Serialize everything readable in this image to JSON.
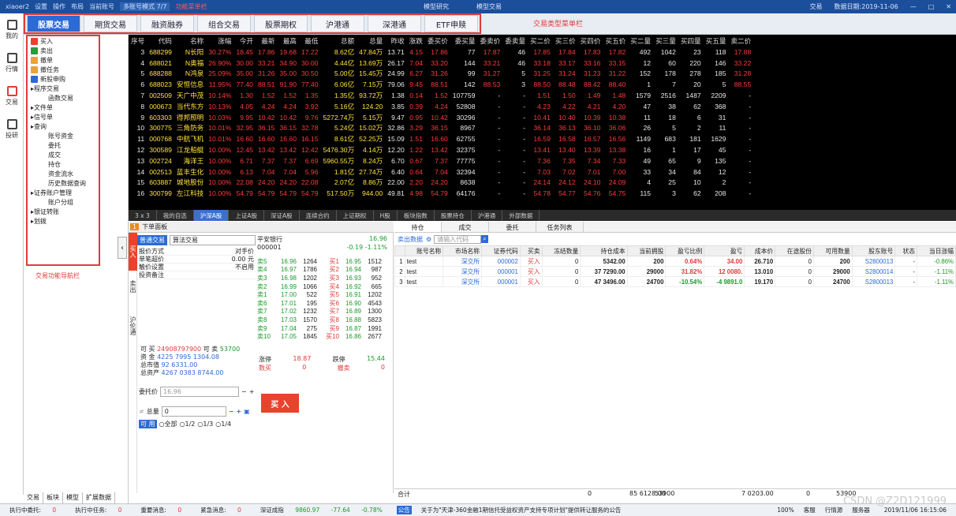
{
  "titlebar": {
    "user": "xiaoer2",
    "settings": "设置",
    "operate": "操作",
    "layout": "布局",
    "account_label": "当前账号",
    "account_mode": "多账号模式 7/7",
    "top_note": "功能菜单栏",
    "research": "模型研究",
    "model_trade": "模型交易",
    "trade": "交易",
    "date": "数据日期:2019-11-06"
  },
  "iconbar": [
    {
      "label": "我的",
      "icon": "home-icon"
    },
    {
      "label": "行情",
      "icon": "chart-icon"
    },
    {
      "label": "交易",
      "icon": "trade-icon"
    },
    {
      "label": "投研",
      "icon": "research-icon"
    }
  ],
  "tabs": [
    "股票交易",
    "期货交易",
    "融资融券",
    "组合交易",
    "股票期权",
    "沪港通",
    "深港通",
    "ETF申赎"
  ],
  "tabs_note": "交易类型菜单栏",
  "nav": [
    {
      "label": "买入",
      "kind": "item",
      "color": "#e8432c"
    },
    {
      "label": "卖出",
      "kind": "item",
      "color": "#2a9a3a"
    },
    {
      "label": "撤单",
      "kind": "item",
      "color": "#e9a23b"
    },
    {
      "label": "撤任务",
      "kind": "item",
      "color": "#e9a23b"
    },
    {
      "label": "新股申购",
      "kind": "item",
      "color": "#2c6ad6"
    },
    {
      "label": "程序交易",
      "kind": "grp"
    },
    {
      "label": "函数交易",
      "kind": "sub"
    },
    {
      "label": "文件单",
      "kind": "grp"
    },
    {
      "label": "信号单",
      "kind": "grp"
    },
    {
      "label": "查询",
      "kind": "grp"
    },
    {
      "label": "账号资金",
      "kind": "sub"
    },
    {
      "label": "委托",
      "kind": "sub"
    },
    {
      "label": "成交",
      "kind": "sub"
    },
    {
      "label": "持仓",
      "kind": "sub"
    },
    {
      "label": "资金流水",
      "kind": "sub"
    },
    {
      "label": "历史数据查询",
      "kind": "sub"
    },
    {
      "label": "证券账户管理",
      "kind": "grp"
    },
    {
      "label": "账户分组",
      "kind": "sub"
    },
    {
      "label": "银证转账",
      "kind": "grp"
    },
    {
      "label": "划拨",
      "kind": "grp"
    }
  ],
  "nav_note": "交易功能导航栏",
  "left_bottom_tabs": [
    "交易",
    "板块",
    "模型",
    "扩展数据"
  ],
  "quote": {
    "headers": [
      "序号",
      "代码",
      "名称",
      "涨幅",
      "今开",
      "最新",
      "最高",
      "最低",
      "总额",
      "总量",
      "昨收",
      "涨跌",
      "委买价",
      "委买量",
      "委卖价",
      "委卖量",
      "买二价",
      "买三价",
      "买四价",
      "买五价",
      "买二量",
      "买三量",
      "买四量",
      "买五量",
      "卖二价"
    ],
    "rows": [
      [
        "3",
        "688299",
        "N长阳",
        "30.27%",
        "18.45",
        "17.86",
        "19.68",
        "17.22",
        "8.62亿",
        "47.84万",
        "13.71",
        "4.15",
        "17.86",
        "77",
        "17.87",
        "46",
        "17.85",
        "17.84",
        "17.83",
        "17.82",
        "492",
        "1042",
        "23",
        "118",
        "17.88"
      ],
      [
        "4",
        "688021",
        "N奥福",
        "26.90%",
        "30.00",
        "33.21",
        "34.90",
        "30.00",
        "4.44亿",
        "13.69万",
        "26.17",
        "7.04",
        "33.20",
        "144",
        "33.21",
        "46",
        "33.18",
        "33.17",
        "33.16",
        "33.15",
        "12",
        "60",
        "220",
        "146",
        "33.22"
      ],
      [
        "5",
        "688288",
        "N鸿泉",
        "25.09%",
        "35.00",
        "31.26",
        "35.00",
        "30.50",
        "5.00亿",
        "15.45万",
        "24.99",
        "6.27",
        "31.26",
        "99",
        "31.27",
        "5",
        "31.25",
        "31.24",
        "31.23",
        "31.22",
        "152",
        "178",
        "278",
        "185",
        "31.28"
      ],
      [
        "6",
        "688023",
        "安恒信息",
        "11.95%",
        "77.40",
        "88.51",
        "91.90",
        "77.40",
        "6.06亿",
        "7.15万",
        "79.06",
        "9.45",
        "88.51",
        "142",
        "88.53",
        "3",
        "88.50",
        "88.48",
        "88.42",
        "88.40",
        "1",
        "7",
        "20",
        "5",
        "88.55"
      ],
      [
        "7",
        "002509",
        "天广中茂",
        "10.14%",
        "1.30",
        "1.52",
        "1.52",
        "1.35",
        "1.35亿",
        "93.72万",
        "1.38",
        "0.14",
        "1.52",
        "107759",
        "-",
        "-",
        "1.51",
        "1.50",
        "1.49",
        "1.48",
        "1579",
        "2516",
        "1487",
        "2209",
        "-"
      ],
      [
        "8",
        "000673",
        "当代东方",
        "10.13%",
        "4.05",
        "4.24",
        "4.24",
        "3.92",
        "5.16亿",
        "124.20",
        "3.85",
        "0.39",
        "4.24",
        "52808",
        "-",
        "-",
        "4.23",
        "4.22",
        "4.21",
        "4.20",
        "47",
        "38",
        "62",
        "368",
        "-"
      ],
      [
        "9",
        "603303",
        "得邦照明",
        "10.03%",
        "9.95",
        "10.42",
        "10.42",
        "9.76",
        "5272.74万",
        "5.15万",
        "9.47",
        "0.95",
        "10.42",
        "30296",
        "-",
        "-",
        "10.41",
        "10.40",
        "10.39",
        "10.38",
        "11",
        "18",
        "6",
        "31",
        "-"
      ],
      [
        "10",
        "300775",
        "三角防务",
        "10.01%",
        "32.95",
        "36.15",
        "36.15",
        "32.78",
        "5.24亿",
        "15.02万",
        "32.86",
        "3.29",
        "36.15",
        "8967",
        "-",
        "-",
        "36.14",
        "36.13",
        "36.10",
        "36.06",
        "26",
        "5",
        "2",
        "11",
        "-"
      ],
      [
        "11",
        "000768",
        "中航飞机",
        "10.01%",
        "16.60",
        "16.60",
        "16.60",
        "16.15",
        "8.61亿",
        "52.25万",
        "15.09",
        "1.51",
        "16.60",
        "62755",
        "-",
        "-",
        "16.59",
        "16.58",
        "16.57",
        "16.56",
        "1149",
        "683",
        "181",
        "1629",
        "-"
      ],
      [
        "12",
        "300589",
        "江龙船艇",
        "10.00%",
        "12.45",
        "13.42",
        "13.42",
        "12.42",
        "5476.30万",
        "4.14万",
        "12.20",
        "1.22",
        "13.42",
        "32375",
        "-",
        "-",
        "13.41",
        "13.40",
        "13.39",
        "13.38",
        "16",
        "1",
        "17",
        "45",
        "-"
      ],
      [
        "13",
        "002724",
        "海洋王",
        "10.00%",
        "6.71",
        "7.37",
        "7.37",
        "6.69",
        "5960.55万",
        "8.24万",
        "6.70",
        "0.67",
        "7.37",
        "77775",
        "-",
        "-",
        "7.36",
        "7.35",
        "7.34",
        "7.33",
        "49",
        "65",
        "9",
        "135",
        "-"
      ],
      [
        "14",
        "002513",
        "蓝丰生化",
        "10.00%",
        "6.13",
        "7.04",
        "7.04",
        "5.96",
        "1.81亿",
        "27.74万",
        "6.40",
        "0.64",
        "7.04",
        "32394",
        "-",
        "-",
        "7.03",
        "7.02",
        "7.01",
        "7.00",
        "33",
        "34",
        "84",
        "12",
        "-"
      ],
      [
        "15",
        "603887",
        "城地股份",
        "10.00%",
        "22.08",
        "24.20",
        "24.20",
        "22.08",
        "2.07亿",
        "8.86万",
        "22.00",
        "2.20",
        "24.20",
        "8638",
        "-",
        "-",
        "24.14",
        "24.12",
        "24.10",
        "24.09",
        "4",
        "25",
        "10",
        "2",
        "-"
      ],
      [
        "16",
        "300799",
        "左江科技",
        "10.00%",
        "54.79",
        "54.79",
        "54.79",
        "54.79",
        "517.50万",
        "944.00",
        "49.81",
        "4.98",
        "54.79",
        "64176",
        "-",
        "-",
        "54.78",
        "54.77",
        "54.76",
        "54.75",
        "115",
        "3",
        "62",
        "208",
        "-"
      ]
    ]
  },
  "subtabs": [
    "3 x 3",
    "我的自选",
    "沪深A股",
    "上证A股",
    "深证A股",
    "连续合约",
    "上证期权",
    "H股",
    "板块指数",
    "股票持仓",
    "沪港通",
    "外部数据"
  ],
  "order": {
    "panel_title": "下单面板",
    "mode_tab": "普通交易",
    "mode_select": "算法交易",
    "side_tabs": [
      "买入",
      "卖出",
      "沪伦通"
    ],
    "form": [
      {
        "k": "报价方式",
        "v": "对手价"
      },
      {
        "k": "单笔超价",
        "v": "0.00 元"
      },
      {
        "k": "触价设置",
        "v": "不启用"
      },
      {
        "k": "投资备注",
        "v": ""
      }
    ],
    "stock_name": "平安银行",
    "stock_code": "000001",
    "stock_price": "16.96",
    "stock_chg": "-0.19",
    "stock_pct": "-1.11%",
    "depth": [
      {
        "sl": "卖5",
        "sp": "16.96",
        "sv": "1264",
        "bl": "买1",
        "bp": "16.95",
        "bv": "1512"
      },
      {
        "sl": "卖4",
        "sp": "16.97",
        "sv": "1786",
        "bl": "买2",
        "bp": "16.94",
        "bv": "987"
      },
      {
        "sl": "卖3",
        "sp": "16.98",
        "sv": "1202",
        "bl": "买3",
        "bp": "16.93",
        "bv": "952"
      },
      {
        "sl": "卖2",
        "sp": "16.99",
        "sv": "1066",
        "bl": "买4",
        "bp": "16.92",
        "bv": "665"
      },
      {
        "sl": "卖1",
        "sp": "17.00",
        "sv": "522",
        "bl": "买5",
        "bp": "16.91",
        "bv": "1202"
      },
      {
        "sl": "卖6",
        "sp": "17.01",
        "sv": "195",
        "bl": "买6",
        "bp": "16.90",
        "bv": "4543"
      },
      {
        "sl": "卖7",
        "sp": "17.02",
        "sv": "1232",
        "bl": "买7",
        "bp": "16.89",
        "bv": "1300"
      },
      {
        "sl": "卖8",
        "sp": "17.03",
        "sv": "1570",
        "bl": "买8",
        "bp": "16.88",
        "bv": "5823"
      },
      {
        "sl": "卖9",
        "sp": "17.04",
        "sv": "275",
        "bl": "买9",
        "bp": "16.87",
        "bv": "1991"
      },
      {
        "sl": "卖10",
        "sp": "17.05",
        "sv": "1845",
        "bl": "买10",
        "bp": "16.86",
        "bv": "2677"
      }
    ],
    "funds": {
      "buyable_label": "可 买",
      "buyable": "24908797900",
      "sellable_label": "可 卖",
      "sellable": "53700",
      "cash_label": "资 金",
      "cash": "4225 7995 1304.08",
      "mv_label": "总市值",
      "mv": "92 6331.00",
      "assets_label": "总资产",
      "assets": "4267 0383 8744.00"
    },
    "limit_up_label": "涨停",
    "limit_up": "18.87",
    "limit_down_label": "跌停",
    "limit_down": "15.44",
    "count_label": "数买",
    "count": "0",
    "cancel_label": "撤卖",
    "cancel": "0",
    "price_label": "委托价",
    "price_placeholder": "16.96",
    "qty_label": "总量",
    "qty_value": "0",
    "ratio_label": "可 用",
    "ratio_opts": [
      "全部",
      "1/2",
      "1/3",
      "1/4"
    ],
    "buy_btn": "买 入"
  },
  "positions": {
    "tabs": [
      "持仓",
      "成交",
      "委托",
      "任务列表"
    ],
    "export": "卖出数据",
    "search_placeholder": "请输入代码",
    "headers": [
      "",
      "账号名称",
      "市场名称",
      "证券代码",
      "买卖",
      "冻结数量",
      "持仓成本",
      "当前拥股",
      "盈亏比例",
      "盈亏",
      "成本价",
      "在途股份",
      "可用数量",
      "股东账号",
      "状态",
      "当日涨幅"
    ],
    "rows": [
      [
        "1",
        "test",
        "深交所",
        "000002",
        "买入",
        "0",
        "5342.00",
        "200",
        "0.64%",
        "34.00",
        "26.710",
        "0",
        "200",
        "S2800013",
        "-",
        "-0.86%"
      ],
      [
        "2",
        "test",
        "深交所",
        "000001",
        "买入",
        "0",
        "37 7290.00",
        "29000",
        "31.82%",
        "12 0080.",
        "13.010",
        "0",
        "29000",
        "S2800014",
        "-",
        "-1.11%"
      ],
      [
        "3",
        "test",
        "深交所",
        "000001",
        "买入",
        "0",
        "47 3496.00",
        "24700",
        "-10.54%",
        "-4 9891.0",
        "19.170",
        "0",
        "24700",
        "S2800013",
        "-",
        "-1.11%"
      ]
    ],
    "total_label": "合计",
    "total": [
      "0",
      "85 6128.00",
      "53900",
      "",
      "7 0203.00",
      "",
      "0",
      "53900"
    ]
  },
  "statusbar": {
    "exec_label": "执行中委托:",
    "exec": "0",
    "task_label": "执行中任务:",
    "task": "0",
    "msg_label": "重要消息:",
    "msg": "0",
    "urgent_label": "紧急消息:",
    "urgent": "0",
    "index_name": "深证成指",
    "index_val": "9860.97",
    "index_chg": "-77.64",
    "index_pct": "-0.78%",
    "notice_tag": "公告",
    "notice": "关于为\"天津-360金融1期信托受益权资产支持专项计划\"提供转让服务的公告",
    "zoom": "100%",
    "service": "客服",
    "hq": "行情源",
    "server": "服务器",
    "time": "2019/11/06 16:15:06",
    "watermark": "CSDN @Z2D121999"
  }
}
